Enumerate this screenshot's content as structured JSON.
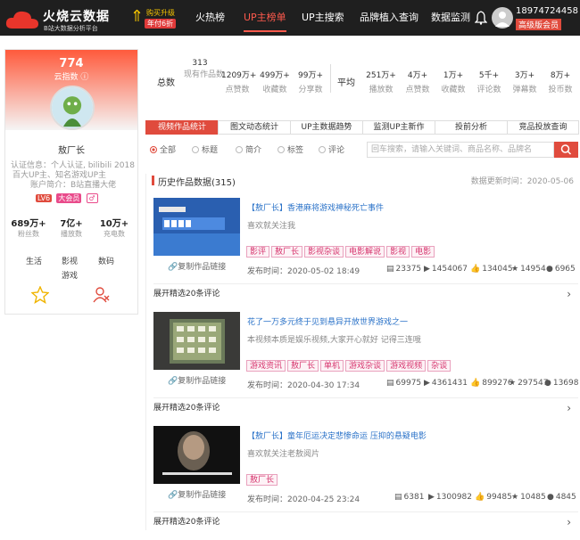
{
  "nav": {
    "logo_title": "火烧云数据",
    "logo_sub": "B站大数据分析平台",
    "promo_line1": "购买升级",
    "promo_line2": "年付6折",
    "items": [
      {
        "label": "火热榜"
      },
      {
        "label": "UP主榜单"
      },
      {
        "label": "UP主搜索"
      },
      {
        "label": "品牌植入查询"
      },
      {
        "label": "数据监测"
      }
    ],
    "phone": "18974724458",
    "vip": "高级版会员"
  },
  "profile": {
    "score": "774",
    "score_label": "云指数",
    "name": "敖厂长",
    "cert_line1": "认证信息：个人认证, bilibili 2018",
    "cert_line2": "百大UP主、知名游戏UP主",
    "intro": "账户简介：B站直播大佬",
    "badges": [
      "LV6",
      "大会员",
      "♂"
    ],
    "stats": [
      {
        "value": "689万+",
        "label": "粉丝数"
      },
      {
        "value": "7亿+",
        "label": "播放数"
      },
      {
        "value": "10万+",
        "label": "充电数"
      }
    ],
    "categories": [
      "生活",
      "影视",
      "数码",
      "游戏"
    ]
  },
  "summary": {
    "total_label": "总数",
    "avg_label": "平均",
    "totals": [
      {
        "value": "313",
        "label": "现有作品数"
      },
      {
        "value": "1209万+",
        "label": "点赞数"
      },
      {
        "value": "499万+",
        "label": "收藏数"
      },
      {
        "value": "99万+",
        "label": "分享数"
      }
    ],
    "averages": [
      {
        "value": "251万+",
        "label": "播放数"
      },
      {
        "value": "4万+",
        "label": "点赞数"
      },
      {
        "value": "1万+",
        "label": "收藏数"
      },
      {
        "value": "5千+",
        "label": "评论数"
      },
      {
        "value": "3万+",
        "label": "弹幕数"
      },
      {
        "value": "8万+",
        "label": "投币数"
      }
    ]
  },
  "tabs": [
    "视频作品统计",
    "图文动态统计",
    "UP主数据趋势",
    "监测UP主新作",
    "投前分析",
    "竞品投放查询"
  ],
  "filters": [
    "全部",
    "标题",
    "简介",
    "标签",
    "评论"
  ],
  "search_placeholder": "回车搜索，请输入关键词、商品名称、品牌名",
  "list": {
    "title": "历史作品数据(315)",
    "updated": "数据更新时间：2020-05-06",
    "copy_label": "复制作品链接",
    "expand_label": "展开精选20条评论",
    "items": [
      {
        "title": "【敖厂长】香港麻将游戏神秘死亡事件",
        "desc": "喜欢就关注我",
        "tags": [
          "影评",
          "敖厂长",
          "影视杂谈",
          "电影解说",
          "影视",
          "电影"
        ],
        "pub": "发布时间：2020-05-02 18:49",
        "m": [
          "23375",
          "1454067",
          "134045",
          "14954",
          "6965"
        ]
      },
      {
        "title": "花了一万多元终于见到悬异开放世界游戏之一",
        "desc": "本视频本质是娱乐视频,大家开心就好 记得三连哦",
        "tags": [
          "游戏资讯",
          "敖厂长",
          "单机",
          "游戏杂谈",
          "游戏视频",
          "杂谈"
        ],
        "pub": "发布时间：2020-04-30 17:34",
        "m": [
          "69975",
          "4361431",
          "899276",
          "297547",
          "13698"
        ]
      },
      {
        "title": "【敖厂长】童年厄运决定悲惨命运 压抑的悬疑电影",
        "desc": "喜欢就关注老敖阅片",
        "tags": [
          "敖厂长"
        ],
        "pub": "发布时间：2020-04-25 23:24",
        "m": [
          "6381",
          "1300982",
          "99485",
          "10485",
          "4845"
        ]
      }
    ]
  }
}
